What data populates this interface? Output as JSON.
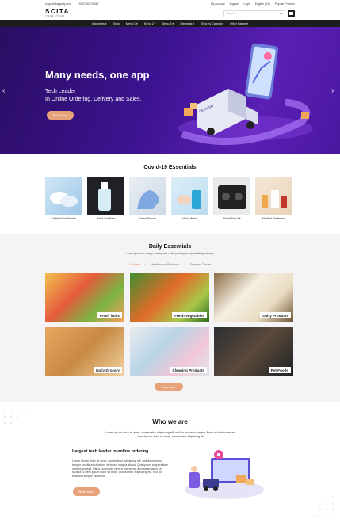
{
  "topbar": {
    "email": "support@appsfly.com",
    "phone": "+91 97667 97668",
    "links": [
      "My Account",
      "Support",
      "Login",
      "English (US)",
      "Popular Provider"
    ]
  },
  "header": {
    "logo": "SCITA",
    "logo_tag": "THEME STORES",
    "search_placeholder": "Search"
  },
  "nav": {
    "items": [
      "Industries",
      "Shop",
      "Menu 1",
      "Menu 2",
      "Menu 3",
      "Elements",
      "Shop by Category",
      "Other Pages"
    ]
  },
  "hero": {
    "title": "Many needs, one app",
    "subtitle_line1": "Tech Leader",
    "subtitle_line2": "In Online Ordering, Delivery and Sales.",
    "button": "Shop Now",
    "truck_text": "DELIVERY"
  },
  "covid": {
    "title": "Covid-19 Essentials",
    "items": [
      "Safety Face Masks",
      "Hand Sanitizer",
      "Hand Gloves",
      "Hand Wash",
      "Rapid Test Kit",
      "Medical Treatment"
    ]
  },
  "daily": {
    "title": "Daily Essentials",
    "subtitle": "Lorem Ipsum is simply dummy text of the printing and typesetting industry.",
    "tabs": [
      "Grocery",
      "Healthcare Products",
      "Staples Corner"
    ],
    "tiles": [
      "Fresh fruits",
      "Fresh Vegetables",
      "Dairy Products",
      "Daily Grocery",
      "Cleaning Products",
      "Pet Foods"
    ],
    "button": "Shop More"
  },
  "who": {
    "title": "Who we are",
    "line1": "Lorem ipsum dolor sit amet, consectetur adipiscing elit, sed do eiusmod tempor. Enim ad minim veniam",
    "line2": "Lorem ipsum dolor sit amet, consectetur adipiscing elit.",
    "heading": "Largest tech leader in online ordering",
    "body": "Lorem ipsum dolor sit amet, consectetur adipiscing elit, sed do eiusmod tempor incididunt ut labore et dolore magna aliqua. Quis ipsum suspendisse ultrices gravida. Risus commodo viverra maecenas accumsan lacus vel facilisis. Lorem ipsum dolor sit amet, consectetur adipiscing elit, sed do eiusmod tempor incididunt.",
    "button": "Read More"
  }
}
